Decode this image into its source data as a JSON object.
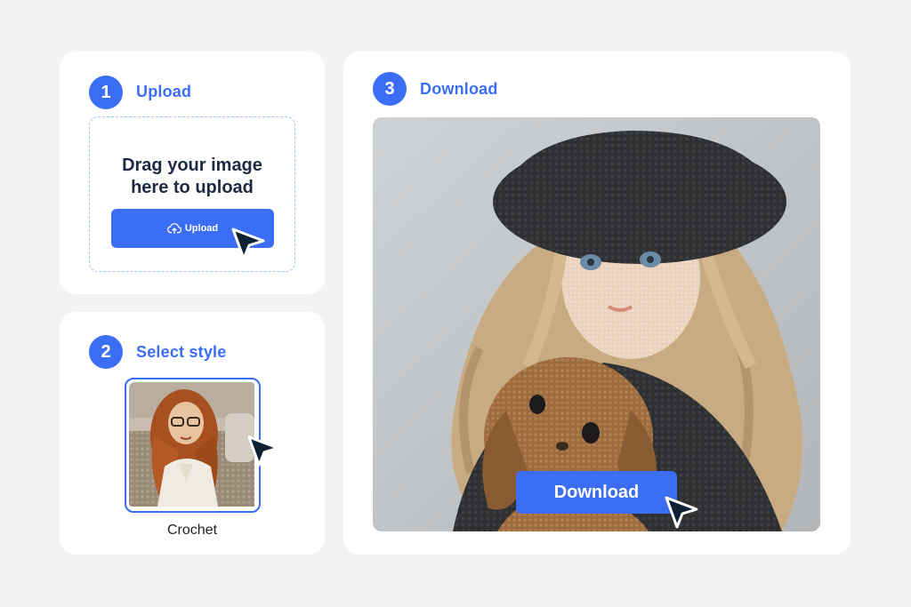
{
  "steps": {
    "upload": {
      "number": "1",
      "title": "Upload",
      "drop_text": "Drag  your image\nhere to upload",
      "button_label": "Upload",
      "button_icon": "cloud-upload-icon"
    },
    "style": {
      "number": "2",
      "title": "Select style",
      "selected_style_label": "Crochet"
    },
    "download": {
      "number": "3",
      "title": "Download",
      "button_label": "Download"
    }
  },
  "colors": {
    "accent": "#3b6ef5",
    "background": "#f3f3f3",
    "card": "#ffffff",
    "cursor": "#0f2233"
  }
}
